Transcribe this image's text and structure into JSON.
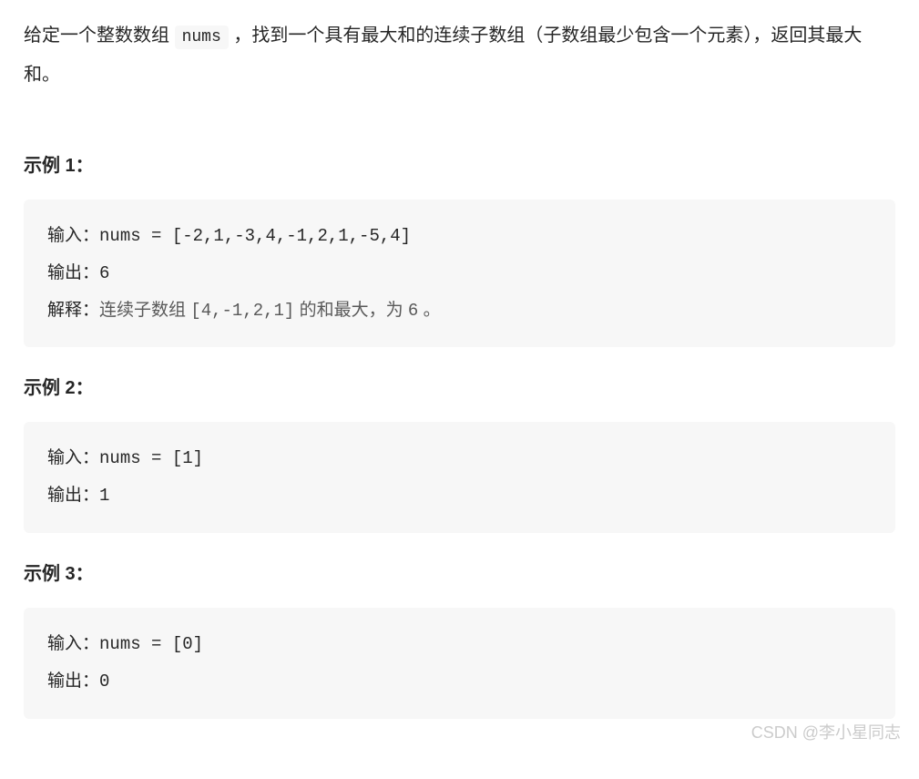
{
  "description": {
    "prefix": "给定一个整数数组 ",
    "code": "nums",
    "suffix": " ，找到一个具有最大和的连续子数组（子数组最少包含一个元素），返回其最大和。"
  },
  "examples": [
    {
      "heading": "示例 1：",
      "input_label": "输入：",
      "input_value": "nums = [-2,1,-3,4,-1,2,1,-5,4]",
      "output_label": "输出：",
      "output_value": "6",
      "explain_label": "解释：",
      "explain_prefix": "连续子数组 ",
      "explain_code": "[4,-1,2,1]",
      "explain_mid": " 的和最大，为 ",
      "explain_value": "6",
      "explain_suffix": " 。"
    },
    {
      "heading": "示例 2：",
      "input_label": "输入：",
      "input_value": "nums = [1]",
      "output_label": "输出：",
      "output_value": "1"
    },
    {
      "heading": "示例 3：",
      "input_label": "输入：",
      "input_value": "nums = [0]",
      "output_label": "输出：",
      "output_value": "0"
    }
  ],
  "watermark": "CSDN @李小星同志"
}
